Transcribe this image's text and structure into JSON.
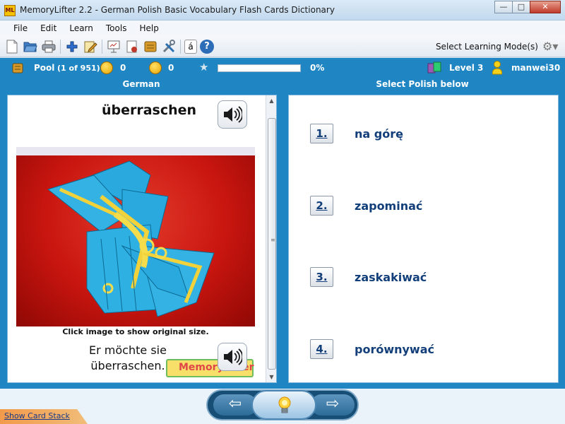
{
  "window": {
    "title": "MemoryLifter 2.2 - German Polish Basic Vocabulary Flash Cards Dictionary",
    "app_icon_text": "ML"
  },
  "menu": [
    "File",
    "Edit",
    "Learn",
    "Tools",
    "Help"
  ],
  "toolbar": {
    "buttons": [
      "new-icon",
      "open-icon",
      "print-icon",
      "add-icon",
      "edit-icon",
      "presentation-icon",
      "statistics-icon",
      "card-icon",
      "settings-tools-icon",
      "special-char-icon",
      "help-icon"
    ],
    "special_char_label": "á",
    "help_label": "?",
    "mode_label": "Select Learning Mode(s)"
  },
  "status": {
    "pool_label": "Pool",
    "pool_count": "(1 of 951)",
    "right_count": "0",
    "wrong_count": "0",
    "progress_percent": 0,
    "progress_text": "0%",
    "level": "Level 3",
    "user": "manwei30"
  },
  "question": {
    "column_title": "German",
    "word": "überraschen",
    "image_caption": "Click image to show original size.",
    "example_line1": "Er möchte sie",
    "example_line2": "überraschen.",
    "logo_text": "MemoryLifter"
  },
  "answers": {
    "column_title": "Select Polish below",
    "options": [
      {
        "number": "1.",
        "text": "na górę"
      },
      {
        "number": "2.",
        "text": "zapominać"
      },
      {
        "number": "3.",
        "text": "zaskakiwać"
      },
      {
        "number": "4.",
        "text": "porównywać"
      }
    ]
  },
  "footer": {
    "show_stack": "Show Card Stack"
  },
  "colors": {
    "accent": "#1f86c3",
    "answer_text": "#123f7a",
    "progress": "#58c25a"
  }
}
